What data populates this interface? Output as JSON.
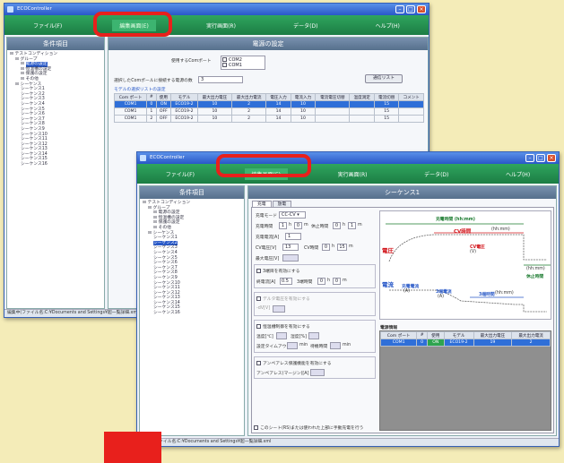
{
  "window1": {
    "title": "ECOController",
    "menu": [
      "ファイル(F)",
      "編集画面(E)",
      "実行画面(R)",
      "データ(D)",
      "ヘルプ(H)"
    ],
    "left_header": "条件項目",
    "tree": [
      "テストコンディション",
      "グループ",
      "電源の設定",
      "恒温槽の設定",
      "保護の設定",
      "その他",
      "シーケンス",
      "シーケンス1",
      "シーケンス2",
      "シーケンス3",
      "シーケンス4",
      "シーケンス5",
      "シーケンス6",
      "シーケンス7",
      "シーケンス8",
      "シーケンス9",
      "シーケンス10",
      "シーケンス11",
      "シーケンス12",
      "シーケンス13",
      "シーケンス14",
      "シーケンス15",
      "シーケンス16"
    ],
    "right_header": "電源の設定",
    "port_label": "使用するComポート",
    "port_options": [
      "COM2",
      "COM1"
    ],
    "count_label": "選択したComポールに接続する電源の数",
    "count_value": "3",
    "list_button": "通信リスト",
    "list_caption": "モデルの選択リストの設定",
    "columns": [
      "Com ポート",
      "#",
      "使用",
      "モデル",
      "最大出力電圧",
      "最大出力電流",
      "電圧入力",
      "電流入力",
      "電流電圧切替",
      "温度測定",
      "電流切替",
      "コメント"
    ],
    "rows": [
      [
        "COM1",
        "0",
        "ON",
        "ECO19-2",
        "10",
        "2",
        "14",
        "10",
        "",
        "",
        "15",
        ""
      ],
      [
        "COM1",
        "1",
        "OFF",
        "ECO19-2",
        "10",
        "2",
        "14",
        "10",
        "",
        "",
        "15",
        ""
      ],
      [
        "COM1",
        "2",
        "OFF",
        "ECO19-2",
        "10",
        "2",
        "14",
        "10",
        "",
        "",
        "15",
        ""
      ]
    ],
    "status": "編集中(ファイル名:C:¥Documents and Settings¥超一覧詳細.xml"
  },
  "window2": {
    "title": "ECOController",
    "menu": [
      "ファイル(F)",
      "編集画面(E)",
      "実行画面(R)",
      "データ(D)",
      "ヘルプ(H)"
    ],
    "left_header": "条件項目",
    "tree": [
      "テストコンディション",
      "グループ",
      "電源の設定",
      "恒温槽の設定",
      "保護の設定",
      "その他",
      "シーケンス",
      "シーケンス1",
      "シーケンス2",
      "シーケンス3",
      "シーケンス4",
      "シーケンス5",
      "シーケンス6",
      "シーケンス7",
      "シーケンス8",
      "シーケンス9",
      "シーケンス10",
      "シーケンス11",
      "シーケンス12",
      "シーケンス13",
      "シーケンス14",
      "シーケンス15",
      "シーケンス16"
    ],
    "selected_tree_index": 8,
    "right_header": "シーケンス1",
    "tabs": [
      "充電",
      "放電"
    ],
    "charge_mode_label": "充電モード",
    "charge_mode_value": "CC-CV",
    "charge_time_label": "充電時間",
    "charge_time_h": "1",
    "charge_time_m": "0",
    "rest_label": "休止時間",
    "rest_h": "0",
    "rest_m": "1",
    "current_label": "充電電流[A]",
    "current_value": "1",
    "cv_label": "CV電圧[V]",
    "cv_value": "13",
    "cv_time_label": "CV時間",
    "cv_h": "0",
    "cv_m": "15",
    "max_label": "最大電圧[V]",
    "end_chk": "3端目を有効にする",
    "end_current_label": "終電流[A]",
    "end_current_value": "0.5",
    "end_time_label": "3端時間",
    "end_h": "0",
    "end_m": "0",
    "delta_chk": "デルタ電圧を有効にする",
    "delta_label": "-dV[V]",
    "temp_chk": "恒温槽制御を有効にする",
    "temp_label": "温度[℃]",
    "humid_label": "湿度[%]",
    "timer_label": "設定タイムアウト",
    "min_label": "min",
    "wait_label": "待機時間",
    "amp_chk": "アンペアレス保護機能を有効にする",
    "amp_label": "アンペアレス(マージン)[A]",
    "diagram": {
      "charge_time": "充電時間 (hh:mm)",
      "cv_time": "CV時間",
      "cv_time_sub": "(hh:mm)",
      "voltage": "電圧",
      "cv_voltage": "CV電圧",
      "cv_voltage_unit": "(V)",
      "charge_current": "充電電流",
      "current_unit": "(A)",
      "end_current": "3端電流",
      "end_current_unit": "(A)",
      "end_time": "3端時間",
      "end_time_sub": "(hh:mm)",
      "rest": "休止時間",
      "rest_sub": "(hh:mm)",
      "current": "電流"
    },
    "supply_list_label": "電源情報",
    "supply_columns": [
      "Com ポート",
      "#",
      "使用",
      "モデル",
      "最大出力電圧",
      "最大出力電流"
    ],
    "supply_row": [
      "COM1",
      "0",
      "ON",
      "ECO19-2",
      "19",
      "2"
    ],
    "bottom_chk": "このシート(RS)または使われた上部に手動充電を行う",
    "status": "編集中(ファイル名:C:¥Documents and Settings¥超一覧詳細.xml"
  },
  "colors": {
    "highlight": "#e8201c",
    "menu": "#1c7d44",
    "title": "#2958c8",
    "panel_header": "#56708c"
  }
}
